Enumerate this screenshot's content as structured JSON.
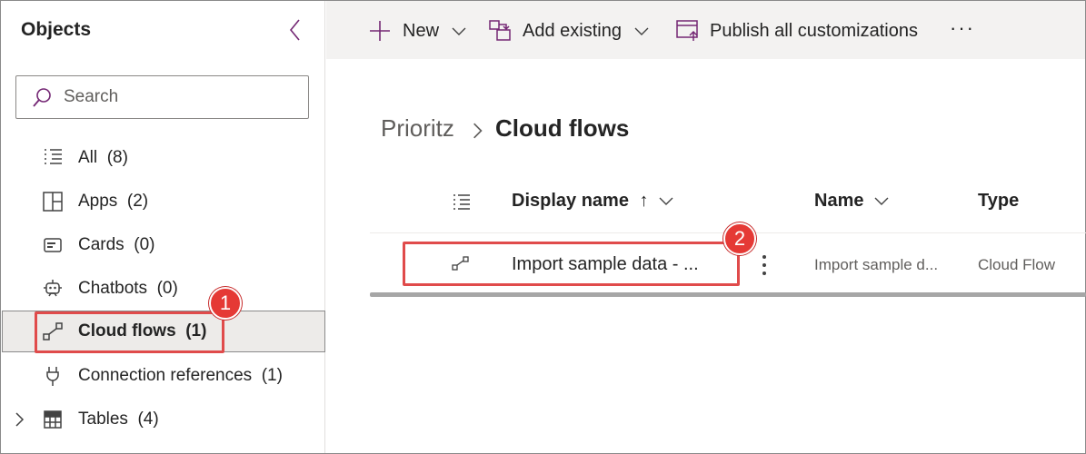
{
  "sidebar": {
    "title": "Objects",
    "search_placeholder": "Search",
    "items": [
      {
        "label": "All",
        "count": "(8)"
      },
      {
        "label": "Apps",
        "count": "(2)"
      },
      {
        "label": "Cards",
        "count": "(0)"
      },
      {
        "label": "Chatbots",
        "count": "(0)"
      },
      {
        "label": "Cloud flows",
        "count": "(1)"
      },
      {
        "label": "Connection references",
        "count": "(1)"
      },
      {
        "label": "Tables",
        "count": "(4)"
      }
    ]
  },
  "commandbar": {
    "new_label": "New",
    "add_existing_label": "Add existing",
    "publish_label": "Publish all customizations",
    "more_label": "···"
  },
  "breadcrumb": {
    "parent": "Prioritz",
    "current": "Cloud flows"
  },
  "table": {
    "columns": {
      "display_name": "Display name",
      "sort_arrow": "↑",
      "name": "Name",
      "type": "Type"
    },
    "rows": [
      {
        "display_name": "Import sample data - ...",
        "name": "Import sample d...",
        "type": "Cloud Flow"
      }
    ]
  },
  "callouts": [
    "1",
    "2"
  ],
  "colors": {
    "accent": "#742774",
    "highlight": "#e04b4b",
    "marker": "#e53935"
  },
  "icons": {
    "collapse": "chevron-left-icon",
    "search": "search-icon",
    "all": "list-icon",
    "apps": "apps-icon",
    "cards": "card-icon",
    "chatbots": "bot-icon",
    "cloud_flows": "flow-icon",
    "connection_references": "plug-icon",
    "tables": "table-icon"
  }
}
